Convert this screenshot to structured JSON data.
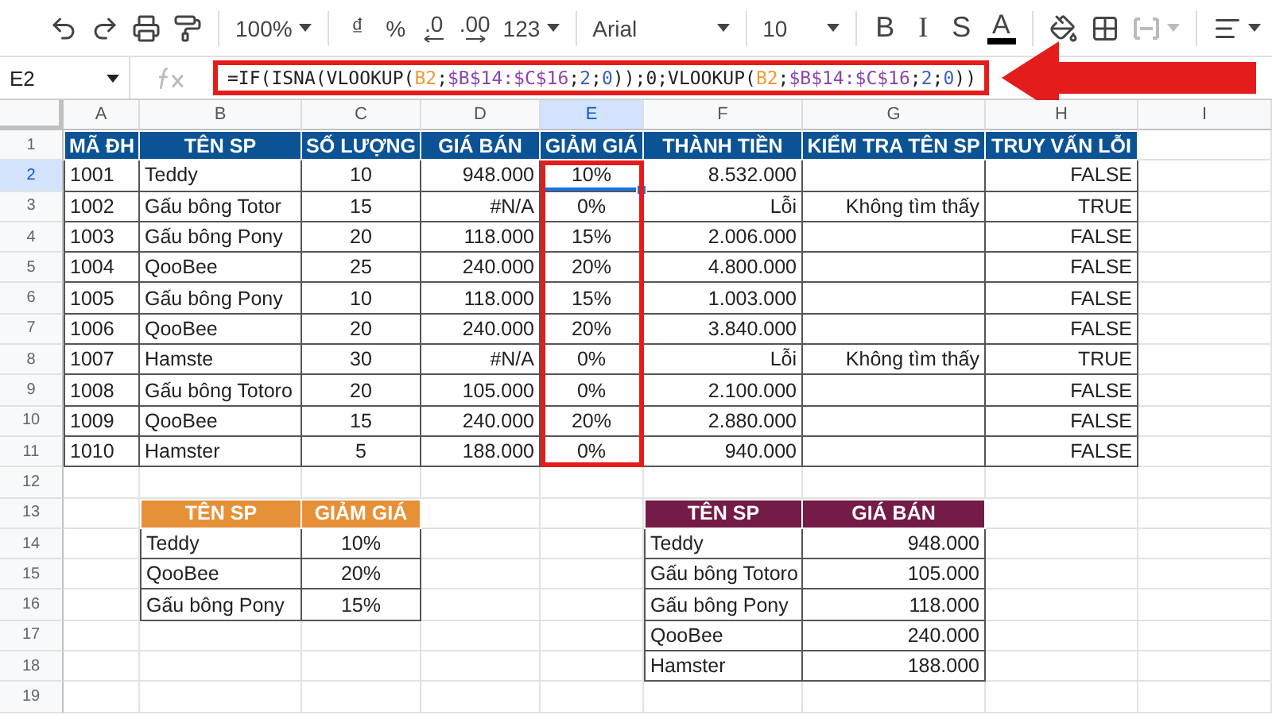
{
  "toolbar": {
    "items": [
      {
        "kind": "undo"
      },
      {
        "kind": "redo"
      },
      {
        "kind": "print"
      },
      {
        "kind": "paint-format"
      },
      {
        "kind": "divider"
      },
      {
        "kind": "text",
        "label": "100%",
        "dropdown": true
      },
      {
        "kind": "divider"
      },
      {
        "kind": "currency",
        "label": "₫"
      },
      {
        "kind": "text",
        "label": "%"
      },
      {
        "kind": "decimal-less",
        "label": ".0"
      },
      {
        "kind": "decimal-more",
        "label": ".00"
      },
      {
        "kind": "text",
        "label": "123",
        "dropdown": true
      },
      {
        "kind": "divider"
      },
      {
        "kind": "font",
        "label": "Arial",
        "dropdown": true
      },
      {
        "kind": "divider"
      },
      {
        "kind": "size",
        "label": "10",
        "dropdown": true
      },
      {
        "kind": "divider"
      },
      {
        "kind": "bold",
        "label": "B"
      },
      {
        "kind": "italic",
        "label": "I"
      },
      {
        "kind": "strike",
        "label": "S"
      },
      {
        "kind": "text-color",
        "label": "A"
      },
      {
        "kind": "divider"
      },
      {
        "kind": "fill"
      },
      {
        "kind": "borders"
      },
      {
        "kind": "merge",
        "dropdown": true,
        "disabled": true
      },
      {
        "kind": "divider"
      },
      {
        "kind": "align",
        "dropdown": true
      }
    ]
  },
  "formula_bar": {
    "name_box": "E2",
    "highlighted": true,
    "arrow": true,
    "formula": [
      {
        "kind": "plain",
        "text": "=IF(ISNA(VLOOKUP("
      },
      {
        "kind": "ref",
        "text": "B2"
      },
      {
        "kind": "plain",
        "text": ";"
      },
      {
        "kind": "range",
        "text": "$B$14:$C$16"
      },
      {
        "kind": "plain",
        "text": ";"
      },
      {
        "kind": "number",
        "text": "2"
      },
      {
        "kind": "plain",
        "text": ";"
      },
      {
        "kind": "number",
        "text": "0"
      },
      {
        "kind": "plain",
        "text": "));0;VLOOKUP("
      },
      {
        "kind": "ref",
        "text": "B2"
      },
      {
        "kind": "plain",
        "text": ";"
      },
      {
        "kind": "range",
        "text": "$B$14:$C$16"
      },
      {
        "kind": "plain",
        "text": ";"
      },
      {
        "kind": "number",
        "text": "2"
      },
      {
        "kind": "plain",
        "text": ";"
      },
      {
        "kind": "number",
        "text": "0"
      },
      {
        "kind": "plain",
        "text": "))"
      }
    ]
  },
  "columns": [
    {
      "letter": "A",
      "selected": false
    },
    {
      "letter": "B",
      "selected": false
    },
    {
      "letter": "C",
      "selected": false
    },
    {
      "letter": "D",
      "selected": false
    },
    {
      "letter": "E",
      "selected": true
    },
    {
      "letter": "F",
      "selected": false
    },
    {
      "letter": "G",
      "selected": false
    },
    {
      "letter": "H",
      "selected": false
    },
    {
      "letter": "I",
      "selected": false
    }
  ],
  "row_numbers": [
    {
      "label": "1",
      "selected": false
    },
    {
      "label": "2",
      "selected": true
    },
    {
      "label": "3",
      "selected": false
    },
    {
      "label": "4",
      "selected": false
    },
    {
      "label": "5",
      "selected": false
    },
    {
      "label": "6",
      "selected": false
    },
    {
      "label": "7",
      "selected": false
    },
    {
      "label": "8",
      "selected": false
    },
    {
      "label": "9",
      "selected": false
    },
    {
      "label": "10",
      "selected": false
    },
    {
      "label": "11",
      "selected": false
    },
    {
      "label": "12",
      "selected": false
    },
    {
      "label": "13",
      "selected": false
    },
    {
      "label": "14",
      "selected": false
    },
    {
      "label": "15",
      "selected": false
    },
    {
      "label": "16",
      "selected": false
    },
    {
      "label": "17",
      "selected": false
    },
    {
      "label": "18",
      "selected": false
    },
    {
      "label": "19",
      "selected": false
    }
  ],
  "tables": [
    {
      "kind": "orders",
      "color": "#0b5394",
      "columns": [
        {
          "label": "MÃ ĐH",
          "kind": "text",
          "highlighted": false
        },
        {
          "label": "TÊN SP",
          "kind": "text",
          "highlighted": false
        },
        {
          "label": "SỐ LƯỢNG",
          "kind": "center",
          "highlighted": false
        },
        {
          "label": "GIÁ BÁN",
          "kind": "number",
          "highlighted": false
        },
        {
          "label": "GIẢM GIÁ",
          "kind": "center",
          "highlighted": true
        },
        {
          "label": "THÀNH TIỀN",
          "kind": "number",
          "highlighted": false
        },
        {
          "label": "KIỂM TRA TÊN SP",
          "kind": "number",
          "highlighted": false
        },
        {
          "label": "TRUY VẤN LỖI",
          "kind": "number",
          "highlighted": false
        }
      ],
      "rows": [
        [
          "1001",
          "Teddy",
          "10",
          "948.000",
          "10%",
          "8.532.000",
          "",
          "FALSE"
        ],
        [
          "1002",
          "Gấu bông Totor",
          "15",
          "#N/A",
          "0%",
          "Lỗi",
          "Không tìm thấy",
          "TRUE"
        ],
        [
          "1003",
          "Gấu bông Pony",
          "20",
          "118.000",
          "15%",
          "2.006.000",
          "",
          "FALSE"
        ],
        [
          "1004",
          "QooBee",
          "25",
          "240.000",
          "20%",
          "4.800.000",
          "",
          "FALSE"
        ],
        [
          "1005",
          "Gấu bông Pony",
          "10",
          "118.000",
          "15%",
          "1.003.000",
          "",
          "FALSE"
        ],
        [
          "1006",
          "QooBee",
          "20",
          "240.000",
          "20%",
          "3.840.000",
          "",
          "FALSE"
        ],
        [
          "1007",
          "Hamste",
          "30",
          "#N/A",
          "0%",
          "Lỗi",
          "Không tìm thấy",
          "TRUE"
        ],
        [
          "1008",
          "Gấu bông Totoro",
          "20",
          "105.000",
          "0%",
          "2.100.000",
          "",
          "FALSE"
        ],
        [
          "1009",
          "QooBee",
          "15",
          "240.000",
          "20%",
          "2.880.000",
          "",
          "FALSE"
        ],
        [
          "1010",
          "Hamster",
          "5",
          "188.000",
          "0%",
          "940.000",
          "",
          "FALSE"
        ]
      ]
    },
    {
      "kind": "discounts",
      "color": "#e69138",
      "columns": [
        {
          "label": "TÊN SP",
          "kind": "text",
          "highlighted": false
        },
        {
          "label": "GIẢM GIÁ",
          "kind": "center",
          "highlighted": false
        }
      ],
      "rows": [
        [
          "Teddy",
          "10%"
        ],
        [
          "QooBee",
          "20%"
        ],
        [
          "Gấu bông Pony",
          "15%"
        ]
      ]
    },
    {
      "kind": "prices",
      "color": "#741b47",
      "columns": [
        {
          "label": "TÊN SP",
          "kind": "text",
          "highlighted": false
        },
        {
          "label": "GIÁ BÁN",
          "kind": "number",
          "highlighted": false
        }
      ],
      "rows": [
        [
          "Teddy",
          "948.000"
        ],
        [
          "Gấu bông Totoro",
          "105.000"
        ],
        [
          "Gấu bông Pony",
          "118.000"
        ],
        [
          "QooBee",
          "240.000"
        ],
        [
          "Hamster",
          "188.000"
        ]
      ]
    }
  ]
}
